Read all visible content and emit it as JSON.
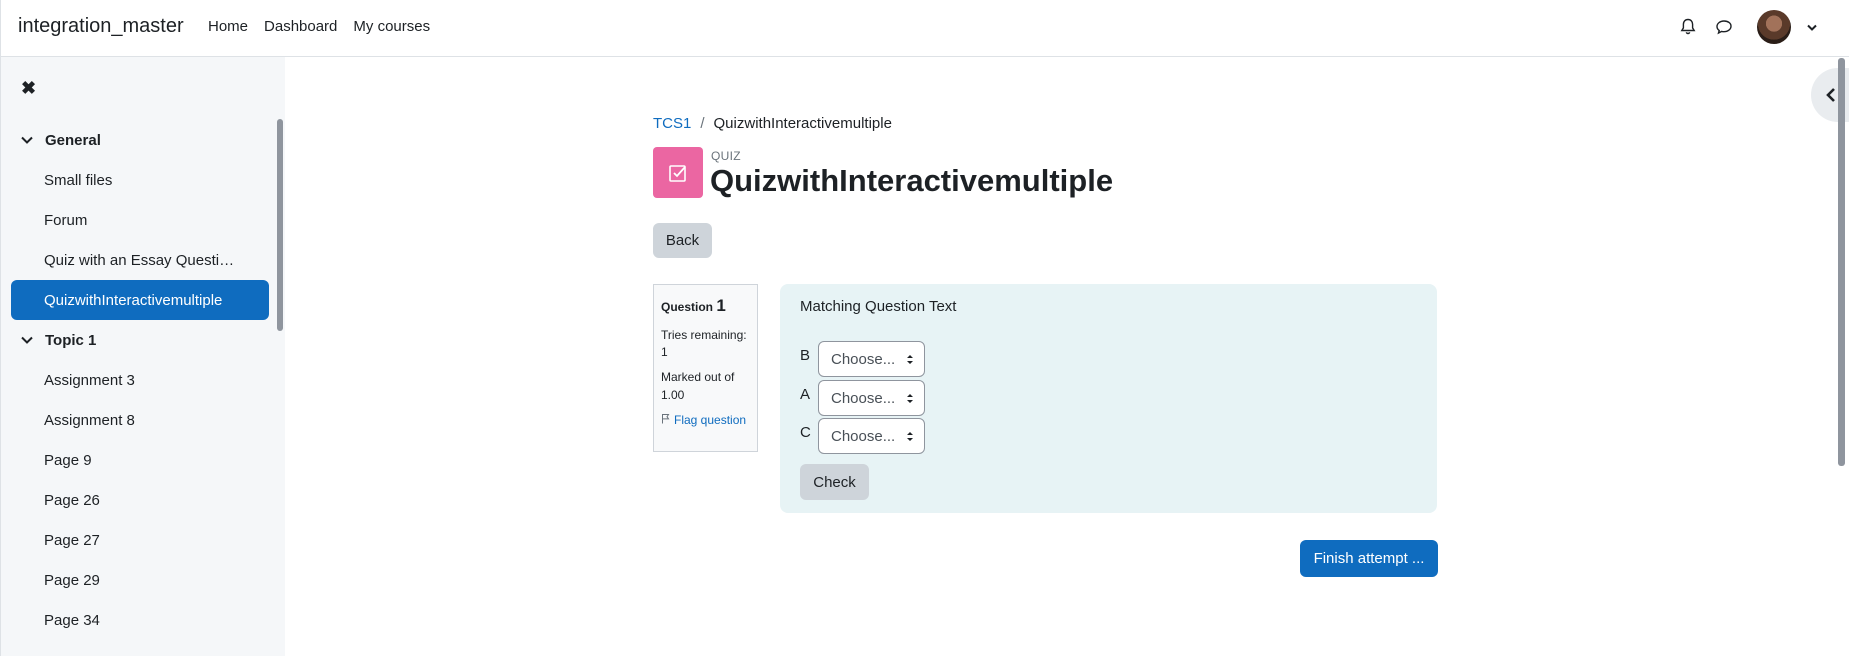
{
  "navbar": {
    "brand": "integration_master",
    "links": [
      "Home",
      "Dashboard",
      "My courses"
    ]
  },
  "icons": {
    "notifications": "bell-icon",
    "messages": "chat-icon",
    "close": "close-icon",
    "drawer": "chevron-left-icon"
  },
  "sidebar": {
    "sections": [
      {
        "title": "General",
        "items": [
          {
            "label": "Small files",
            "active": false
          },
          {
            "label": "Forum",
            "active": false
          },
          {
            "label": "Quiz with an Essay Questi…",
            "active": false
          },
          {
            "label": "QuizwithInteractivemultiple",
            "active": true
          }
        ]
      },
      {
        "title": "Topic 1",
        "items": [
          {
            "label": "Assignment 3",
            "active": false
          },
          {
            "label": "Assignment 8",
            "active": false
          },
          {
            "label": "Page 9",
            "active": false
          },
          {
            "label": "Page 26",
            "active": false
          },
          {
            "label": "Page 27",
            "active": false
          },
          {
            "label": "Page 29",
            "active": false
          },
          {
            "label": "Page 34",
            "active": false
          }
        ]
      }
    ]
  },
  "breadcrumb": {
    "course": "TCS1",
    "separator": "/",
    "current": "QuizwithInteractivemultiple"
  },
  "header": {
    "module_type": "QUIZ",
    "title": "QuizwithInteractivemultiple",
    "icon_color": "#eb66a2"
  },
  "back_label": "Back",
  "question_info": {
    "question_word": "Question",
    "number": "1",
    "tries": "Tries remaining: 1",
    "marked": "Marked out of 1.00",
    "flag": "Flag question"
  },
  "question": {
    "text": "Matching Question Text",
    "rows": [
      {
        "label": "B",
        "value": "Choose..."
      },
      {
        "label": "A",
        "value": "Choose..."
      },
      {
        "label": "C",
        "value": "Choose..."
      }
    ],
    "check_label": "Check"
  },
  "finish_label": "Finish attempt ...",
  "colors": {
    "primary": "#0f6cbf",
    "question_bg": "#e7f3f5",
    "sidebar_bg": "#f5f7f9"
  }
}
